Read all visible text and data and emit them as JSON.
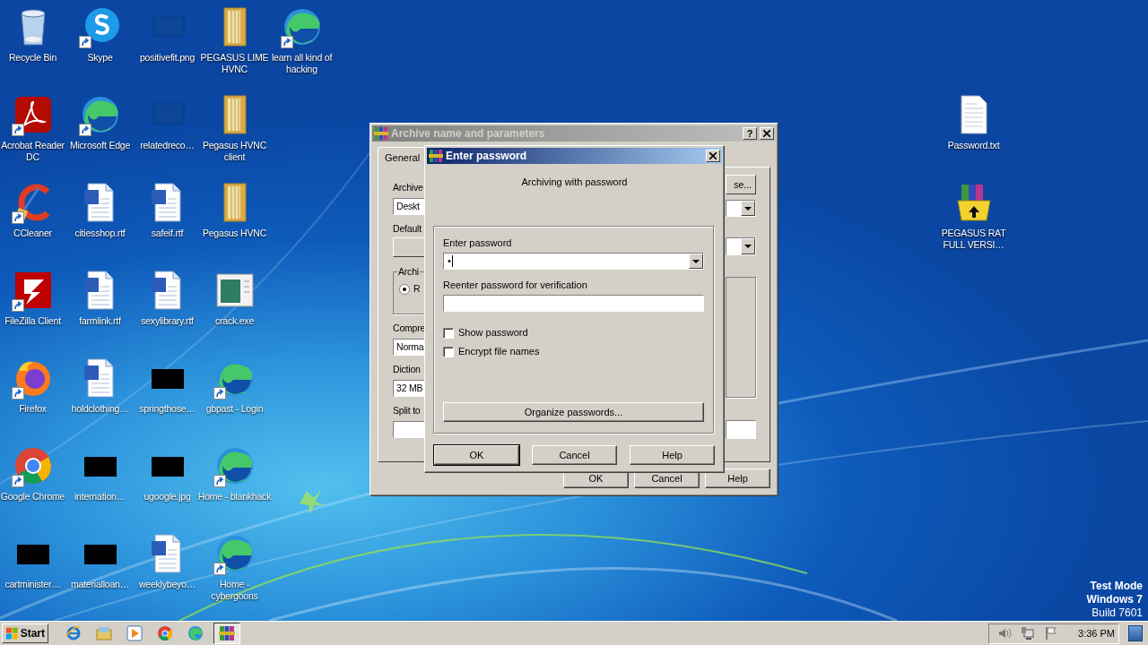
{
  "desktop": {
    "columns": [
      [
        {
          "label": "Recycle Bin",
          "kind": "recycle",
          "shortcut": false
        },
        {
          "label": "Acrobat Reader DC",
          "kind": "acrobat",
          "shortcut": true
        },
        {
          "label": "CCleaner",
          "kind": "ccleaner",
          "shortcut": true
        },
        {
          "label": "FileZilla Client",
          "kind": "filezilla",
          "shortcut": true
        },
        {
          "label": "Firefox",
          "kind": "firefox",
          "shortcut": true
        },
        {
          "label": "Google Chrome",
          "kind": "chrome",
          "shortcut": true
        },
        {
          "label": "cartminister…",
          "kind": "black",
          "shortcut": false
        }
      ],
      [
        {
          "label": "Skype",
          "kind": "skype",
          "shortcut": true
        },
        {
          "label": "Microsoft Edge",
          "kind": "edge",
          "shortcut": true
        },
        {
          "label": "citiesshop.rtf",
          "kind": "word",
          "shortcut": false
        },
        {
          "label": "farmlink.rtf",
          "kind": "word",
          "shortcut": false
        },
        {
          "label": "holdclothing…",
          "kind": "word",
          "shortcut": false
        },
        {
          "label": "internation…",
          "kind": "black",
          "shortcut": false
        },
        {
          "label": "materialloan…",
          "kind": "black",
          "shortcut": false
        }
      ],
      [
        {
          "label": "positivefit.png",
          "kind": "thumb",
          "shortcut": false
        },
        {
          "label": "relatedreco…",
          "kind": "thumb",
          "shortcut": false
        },
        {
          "label": "safeif.rtf",
          "kind": "word",
          "shortcut": false
        },
        {
          "label": "sexylibrary.rtf",
          "kind": "word",
          "shortcut": false
        },
        {
          "label": "springthose…",
          "kind": "black",
          "shortcut": false
        },
        {
          "label": "ugoogle.jpg",
          "kind": "black",
          "shortcut": false
        },
        {
          "label": "weeklybeyo…",
          "kind": "word",
          "shortcut": false
        }
      ],
      [
        {
          "label": "PEGASUS LIME HVNC",
          "kind": "folder",
          "shortcut": false
        },
        {
          "label": "Pegasus HVNC client",
          "kind": "folder",
          "shortcut": false
        },
        {
          "label": "Pegasus HVNC",
          "kind": "folder",
          "shortcut": false
        },
        {
          "label": "crack.exe",
          "kind": "exe",
          "shortcut": false
        },
        {
          "label": "gbpast - Login",
          "kind": "edge",
          "shortcut": true
        },
        {
          "label": "Home - blankhack",
          "kind": "edge",
          "shortcut": true
        },
        {
          "label": "Home - cybergoons",
          "kind": "edge",
          "shortcut": true
        }
      ],
      [
        {
          "label": "learn all kind of hacking",
          "kind": "edge",
          "shortcut": true
        }
      ]
    ],
    "right_column": [
      {
        "label": "Password.txt",
        "kind": "text",
        "shortcut": false
      },
      {
        "label": "PEGASUS RAT FULL VERSI…",
        "kind": "winrar",
        "shortcut": false
      }
    ],
    "system_notice": [
      {
        "text": "Test Mode",
        "bold": true
      },
      {
        "text": "Windows 7",
        "bold": true
      },
      {
        "text": "Build 7601",
        "bold": false
      }
    ]
  },
  "archive_dialog": {
    "title": "Archive name and parameters",
    "help_button": "?",
    "tabs": [
      {
        "label": "General",
        "selected": true
      }
    ],
    "left_column": [
      {
        "kind": "label",
        "text": "Archive"
      },
      {
        "kind": "field",
        "text": "Deskt"
      },
      {
        "kind": "label",
        "text": "Default"
      },
      {
        "kind": "button"
      },
      {
        "kind": "group",
        "text": "Archi",
        "option": {
          "text": "R",
          "selected": true
        }
      },
      {
        "kind": "label",
        "text": "Compre"
      },
      {
        "kind": "combo",
        "text": "Norma"
      },
      {
        "kind": "label",
        "text": "Diction"
      },
      {
        "kind": "field",
        "text": "32 MB"
      },
      {
        "kind": "label",
        "text": "Split to"
      },
      {
        "kind": "field"
      }
    ],
    "right_column": [
      {
        "kind": "button",
        "text": "se..."
      },
      {
        "kind": "combo"
      },
      {
        "kind": "combo"
      },
      {
        "kind": "group"
      },
      {
        "kind": "field"
      }
    ],
    "buttons": [
      "OK",
      "Cancel",
      "Help"
    ]
  },
  "password_dialog": {
    "title": "Enter password",
    "message": "Archiving with password",
    "password_label": "Enter password",
    "password_value": "•",
    "verify_label": "Reenter password for verification",
    "options": [
      {
        "label": "Show password",
        "checked": false
      },
      {
        "label": "Encrypt file names",
        "checked": false
      }
    ],
    "organize_button": "Organize passwords...",
    "buttons": [
      {
        "label": "OK",
        "default": true
      },
      {
        "label": "Cancel",
        "default": false
      },
      {
        "label": "Help",
        "default": false
      }
    ]
  },
  "taskbar": {
    "start_label": "Start",
    "apps": [
      {
        "kind": "ie",
        "active": false
      },
      {
        "kind": "explorer",
        "active": false
      },
      {
        "kind": "media",
        "active": false
      },
      {
        "kind": "chrome",
        "active": false
      },
      {
        "kind": "edge",
        "active": false
      },
      {
        "kind": "winrar",
        "active": true
      }
    ],
    "tray_icons": [
      {
        "kind": "volume"
      },
      {
        "kind": "network"
      },
      {
        "kind": "flag"
      }
    ],
    "clock": "3:36 PM"
  }
}
